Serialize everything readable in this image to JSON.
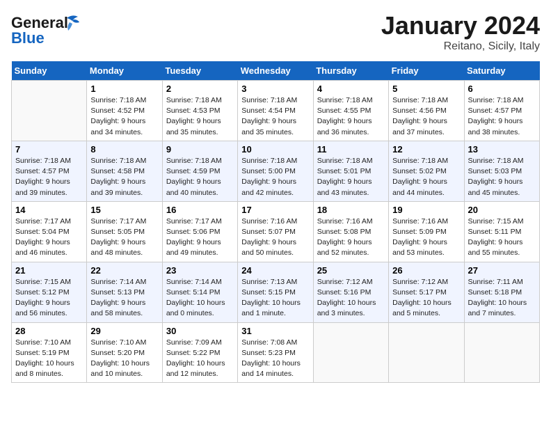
{
  "header": {
    "logo_line1": "General",
    "logo_line2": "Blue",
    "month": "January 2024",
    "location": "Reitano, Sicily, Italy"
  },
  "weekdays": [
    "Sunday",
    "Monday",
    "Tuesday",
    "Wednesday",
    "Thursday",
    "Friday",
    "Saturday"
  ],
  "weeks": [
    [
      {
        "day": "",
        "info": ""
      },
      {
        "day": "1",
        "info": "Sunrise: 7:18 AM\nSunset: 4:52 PM\nDaylight: 9 hours\nand 34 minutes."
      },
      {
        "day": "2",
        "info": "Sunrise: 7:18 AM\nSunset: 4:53 PM\nDaylight: 9 hours\nand 35 minutes."
      },
      {
        "day": "3",
        "info": "Sunrise: 7:18 AM\nSunset: 4:54 PM\nDaylight: 9 hours\nand 35 minutes."
      },
      {
        "day": "4",
        "info": "Sunrise: 7:18 AM\nSunset: 4:55 PM\nDaylight: 9 hours\nand 36 minutes."
      },
      {
        "day": "5",
        "info": "Sunrise: 7:18 AM\nSunset: 4:56 PM\nDaylight: 9 hours\nand 37 minutes."
      },
      {
        "day": "6",
        "info": "Sunrise: 7:18 AM\nSunset: 4:57 PM\nDaylight: 9 hours\nand 38 minutes."
      }
    ],
    [
      {
        "day": "7",
        "info": "Sunrise: 7:18 AM\nSunset: 4:57 PM\nDaylight: 9 hours\nand 39 minutes."
      },
      {
        "day": "8",
        "info": "Sunrise: 7:18 AM\nSunset: 4:58 PM\nDaylight: 9 hours\nand 39 minutes."
      },
      {
        "day": "9",
        "info": "Sunrise: 7:18 AM\nSunset: 4:59 PM\nDaylight: 9 hours\nand 40 minutes."
      },
      {
        "day": "10",
        "info": "Sunrise: 7:18 AM\nSunset: 5:00 PM\nDaylight: 9 hours\nand 42 minutes."
      },
      {
        "day": "11",
        "info": "Sunrise: 7:18 AM\nSunset: 5:01 PM\nDaylight: 9 hours\nand 43 minutes."
      },
      {
        "day": "12",
        "info": "Sunrise: 7:18 AM\nSunset: 5:02 PM\nDaylight: 9 hours\nand 44 minutes."
      },
      {
        "day": "13",
        "info": "Sunrise: 7:18 AM\nSunset: 5:03 PM\nDaylight: 9 hours\nand 45 minutes."
      }
    ],
    [
      {
        "day": "14",
        "info": "Sunrise: 7:17 AM\nSunset: 5:04 PM\nDaylight: 9 hours\nand 46 minutes."
      },
      {
        "day": "15",
        "info": "Sunrise: 7:17 AM\nSunset: 5:05 PM\nDaylight: 9 hours\nand 48 minutes."
      },
      {
        "day": "16",
        "info": "Sunrise: 7:17 AM\nSunset: 5:06 PM\nDaylight: 9 hours\nand 49 minutes."
      },
      {
        "day": "17",
        "info": "Sunrise: 7:16 AM\nSunset: 5:07 PM\nDaylight: 9 hours\nand 50 minutes."
      },
      {
        "day": "18",
        "info": "Sunrise: 7:16 AM\nSunset: 5:08 PM\nDaylight: 9 hours\nand 52 minutes."
      },
      {
        "day": "19",
        "info": "Sunrise: 7:16 AM\nSunset: 5:09 PM\nDaylight: 9 hours\nand 53 minutes."
      },
      {
        "day": "20",
        "info": "Sunrise: 7:15 AM\nSunset: 5:11 PM\nDaylight: 9 hours\nand 55 minutes."
      }
    ],
    [
      {
        "day": "21",
        "info": "Sunrise: 7:15 AM\nSunset: 5:12 PM\nDaylight: 9 hours\nand 56 minutes."
      },
      {
        "day": "22",
        "info": "Sunrise: 7:14 AM\nSunset: 5:13 PM\nDaylight: 9 hours\nand 58 minutes."
      },
      {
        "day": "23",
        "info": "Sunrise: 7:14 AM\nSunset: 5:14 PM\nDaylight: 10 hours\nand 0 minutes."
      },
      {
        "day": "24",
        "info": "Sunrise: 7:13 AM\nSunset: 5:15 PM\nDaylight: 10 hours\nand 1 minute."
      },
      {
        "day": "25",
        "info": "Sunrise: 7:12 AM\nSunset: 5:16 PM\nDaylight: 10 hours\nand 3 minutes."
      },
      {
        "day": "26",
        "info": "Sunrise: 7:12 AM\nSunset: 5:17 PM\nDaylight: 10 hours\nand 5 minutes."
      },
      {
        "day": "27",
        "info": "Sunrise: 7:11 AM\nSunset: 5:18 PM\nDaylight: 10 hours\nand 7 minutes."
      }
    ],
    [
      {
        "day": "28",
        "info": "Sunrise: 7:10 AM\nSunset: 5:19 PM\nDaylight: 10 hours\nand 8 minutes."
      },
      {
        "day": "29",
        "info": "Sunrise: 7:10 AM\nSunset: 5:20 PM\nDaylight: 10 hours\nand 10 minutes."
      },
      {
        "day": "30",
        "info": "Sunrise: 7:09 AM\nSunset: 5:22 PM\nDaylight: 10 hours\nand 12 minutes."
      },
      {
        "day": "31",
        "info": "Sunrise: 7:08 AM\nSunset: 5:23 PM\nDaylight: 10 hours\nand 14 minutes."
      },
      {
        "day": "",
        "info": ""
      },
      {
        "day": "",
        "info": ""
      },
      {
        "day": "",
        "info": ""
      }
    ]
  ]
}
